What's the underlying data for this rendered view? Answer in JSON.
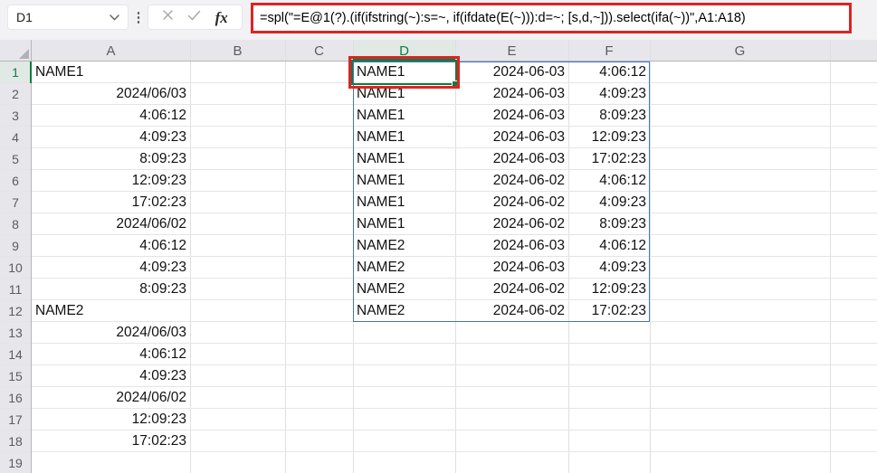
{
  "formula_bar": {
    "name_box_value": "D1",
    "fx_label": "fx",
    "formula": "=spl(\"=E@1(?).(if(ifstring(~):s=~, if(ifdate(E(~))):d=~; [s,d,~])).select(ifa(~))\",A1:A18)"
  },
  "colors": {
    "selection_green": "#107c41",
    "annotation_red": "#e02222",
    "spill_blue": "#4472c4",
    "header_bg": "#e7e6eb",
    "topbar_bg": "#f2f1f4"
  },
  "sheet": {
    "selected_cell": "D1",
    "selected_column": "D",
    "selected_row": "1",
    "row_count": 19,
    "column_headers": [
      "A",
      "B",
      "C",
      "D",
      "E",
      "F",
      "G"
    ],
    "column_a_values": [
      "NAME1",
      "2024/06/03",
      "4:06:12",
      "4:09:23",
      "8:09:23",
      "12:09:23",
      "17:02:23",
      "2024/06/02",
      "4:06:12",
      "4:09:23",
      "8:09:23",
      "NAME2",
      "2024/06/03",
      "4:06:12",
      "4:09:23",
      "2024/06/02",
      "12:09:23",
      "17:02:23"
    ],
    "spill_rows": [
      [
        "NAME1",
        "2024-06-03",
        "4:06:12"
      ],
      [
        "NAME1",
        "2024-06-03",
        "4:09:23"
      ],
      [
        "NAME1",
        "2024-06-03",
        "8:09:23"
      ],
      [
        "NAME1",
        "2024-06-03",
        "12:09:23"
      ],
      [
        "NAME1",
        "2024-06-03",
        "17:02:23"
      ],
      [
        "NAME1",
        "2024-06-02",
        "4:06:12"
      ],
      [
        "NAME1",
        "2024-06-02",
        "4:09:23"
      ],
      [
        "NAME1",
        "2024-06-02",
        "8:09:23"
      ],
      [
        "NAME2",
        "2024-06-03",
        "4:06:12"
      ],
      [
        "NAME2",
        "2024-06-03",
        "4:09:23"
      ],
      [
        "NAME2",
        "2024-06-02",
        "12:09:23"
      ],
      [
        "NAME2",
        "2024-06-02",
        "17:02:23"
      ]
    ]
  }
}
